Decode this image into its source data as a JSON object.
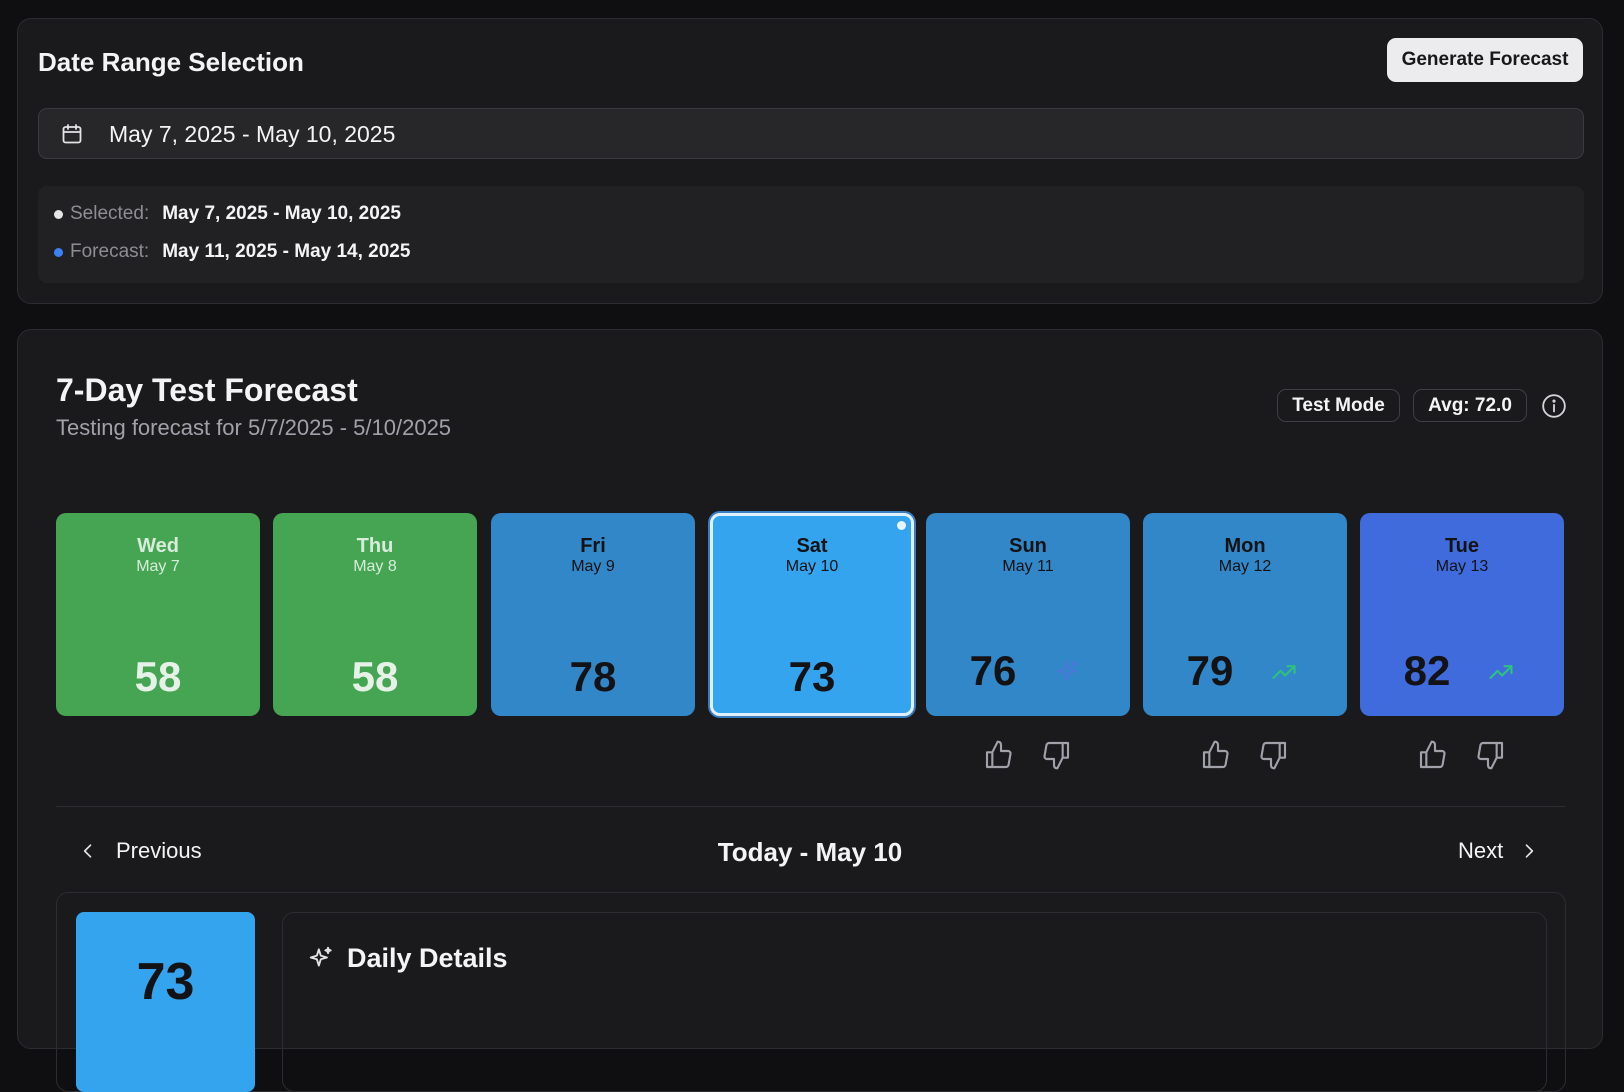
{
  "range": {
    "title": "Date Range Selection",
    "generate_label": "Generate Forecast",
    "date_value": "May 7, 2025 - May 10, 2025",
    "selected_label": "Selected:",
    "selected_value": "May 7, 2025 - May 10, 2025",
    "forecast_label": "Forecast:",
    "forecast_value": "May 11, 2025 - May 14, 2025",
    "selected_dot_color": "#e5e5e7",
    "forecast_dot_color": "#3b82f6"
  },
  "forecast": {
    "title": "7-Day Test Forecast",
    "subtitle": "Testing forecast for 5/7/2025 - 5/10/2025",
    "badge_mode": "Test Mode",
    "badge_avg": "Avg: 72.0",
    "days": [
      {
        "dow": "Wed",
        "date": "May 7",
        "value": "58",
        "color": "#45a552"
      },
      {
        "dow": "Thu",
        "date": "May 8",
        "value": "58",
        "color": "#45a552"
      },
      {
        "dow": "Fri",
        "date": "May 9",
        "value": "78",
        "color": "#3287c9"
      },
      {
        "dow": "Sat",
        "date": "May 10",
        "value": "73",
        "color": "#35a4ee",
        "selected": true
      },
      {
        "dow": "Sun",
        "date": "May 11",
        "value": "76",
        "color": "#3287c9",
        "icon": "sparkle-icon"
      },
      {
        "dow": "Mon",
        "date": "May 12",
        "value": "79",
        "color": "#3287c9",
        "icon": "trend-up-icon"
      },
      {
        "dow": "Tue",
        "date": "May 13",
        "value": "82",
        "color": "#3f6bdc",
        "icon": "trend-up-icon"
      }
    ]
  },
  "nav": {
    "prev_label": "Previous",
    "center_label": "Today - May 10",
    "next_label": "Next"
  },
  "detail": {
    "value": "73",
    "title": "Daily Details"
  }
}
